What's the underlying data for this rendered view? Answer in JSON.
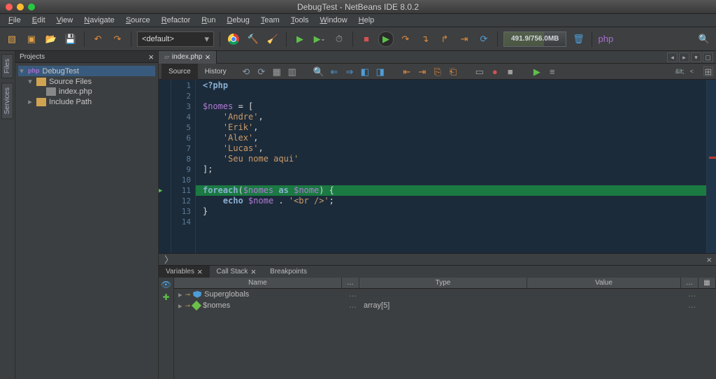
{
  "window": {
    "title": "DebugTest - NetBeans IDE 8.0.2"
  },
  "menus": [
    "File",
    "Edit",
    "View",
    "Navigate",
    "Source",
    "Refactor",
    "Run",
    "Debug",
    "Team",
    "Tools",
    "Window",
    "Help"
  ],
  "toolbar": {
    "config_label": "<default>",
    "memory": "491.9/756.0MB"
  },
  "side_rail": [
    "Files",
    "Services"
  ],
  "projects": {
    "title": "Projects",
    "tree": {
      "root": "DebugTest",
      "root_lang": "php",
      "items": [
        {
          "label": "Source Files",
          "icon": "folder",
          "children": [
            {
              "label": "index.php",
              "icon": "file"
            }
          ]
        },
        {
          "label": "Include Path",
          "icon": "folder"
        }
      ]
    }
  },
  "editor": {
    "tab": {
      "file": "index.php"
    },
    "subtabs": {
      "source": "Source",
      "history": "History"
    },
    "subbar_right": {
      "entity": "&lt;",
      "lt": "<"
    },
    "code_lines": [
      {
        "n": 1,
        "html": "<span class='kw'>&lt;?php</span>"
      },
      {
        "n": 2,
        "html": ""
      },
      {
        "n": 3,
        "html": "<span class='var'>$nomes</span> <span class='op'>=</span> ["
      },
      {
        "n": 4,
        "html": "    <span class='str'>'Andre'</span>,"
      },
      {
        "n": 5,
        "html": "    <span class='str'>'Erik'</span>,"
      },
      {
        "n": 6,
        "html": "    <span class='str'>'Alex'</span>,"
      },
      {
        "n": 7,
        "html": "    <span class='str'>'Lucas'</span>,"
      },
      {
        "n": 8,
        "html": "    <span class='str'>'Seu nome aqui'</span>"
      },
      {
        "n": 9,
        "html": "];"
      },
      {
        "n": 10,
        "html": ""
      },
      {
        "n": 11,
        "html": "<span class='fn'>foreach</span>(<span class='var'>$nomes</span> <span class='fn'>as</span> <span class='var'>$nome</span>) {",
        "current": true
      },
      {
        "n": 12,
        "html": "    <span class='kw'>echo</span> <span class='var'>$nome</span> . <span class='str'>'&lt;br /&gt;'</span>;"
      },
      {
        "n": 13,
        "html": "}"
      },
      {
        "n": 14,
        "html": ""
      }
    ]
  },
  "bottom_tabs": {
    "variables": "Variables",
    "callstack": "Call Stack",
    "breakpoints": "Breakpoints"
  },
  "vars_table": {
    "headers": {
      "name": "Name",
      "type": "Type",
      "value": "Value"
    },
    "rows": [
      {
        "name": "Superglobals",
        "type": "",
        "value": "",
        "icon": "shield",
        "ellipsis": true
      },
      {
        "name": "$nomes",
        "type": "array[5]",
        "value": "",
        "icon": "diamond",
        "ellipsis": true
      }
    ]
  }
}
